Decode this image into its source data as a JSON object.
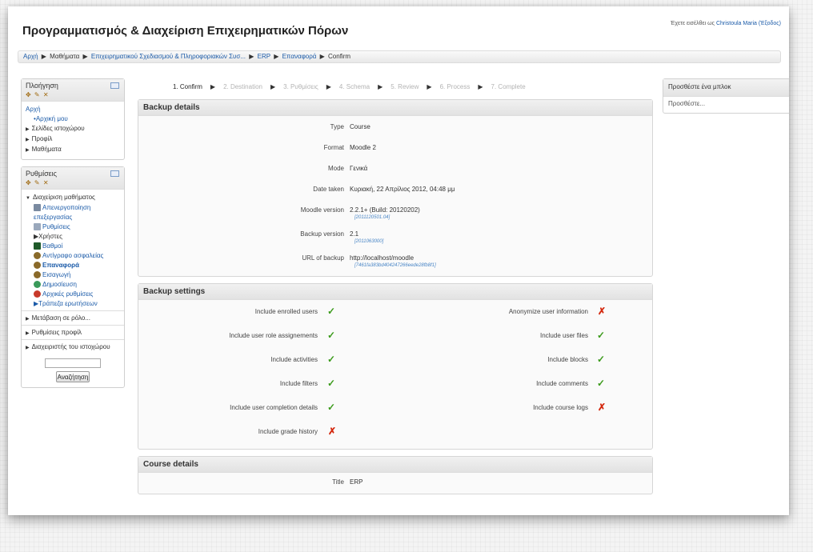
{
  "header": {
    "site_title": "Προγραμματισμός & Διαχείριση Επιχειρηματικών Πόρων",
    "login_text": "Έχετε εισέλθει ως",
    "login_user": "Christoula Maria (Έξοδος)"
  },
  "breadcrumb": {
    "items": [
      "Αρχή",
      "Μαθήματα",
      "Επιχειρηματικού Σχεδιασμού & Πληροφοριακών Συσ...",
      "ERP",
      "Επαναφορά"
    ],
    "current": "Confirm"
  },
  "navigation_block": {
    "title": "Πλοήγηση",
    "home": "Αρχή",
    "items": [
      "Αρχική μου",
      "Σελίδες ιστοχώρου",
      "Προφίλ",
      "Μαθήματα"
    ]
  },
  "settings_block": {
    "title": "Ρυθμίσεις",
    "section": "Διαχείριση μαθήματος",
    "items": [
      "Απενεργοποίηση επεξεργασίας",
      "Ρυθμίσεις",
      "Χρήστες",
      "Βαθμοί",
      "Αντίγραφο ασφαλείας",
      "Επαναφορά",
      "Εισαγωγή",
      "Δημοσίευση",
      "Αρχικές ρυθμίσεις",
      "Τράπεζα ερωτήσεων"
    ],
    "more": [
      "Μετάβαση σε ρόλο...",
      "Ρυθμίσεις προφίλ",
      "Διαχειριστής του ιστοχώρου"
    ],
    "search_button": "Αναζήτηση"
  },
  "stages": [
    "1. Confirm",
    "2. Destination",
    "3. Ρυθμίσεις",
    "4. Schema",
    "5. Review",
    "6. Process",
    "7. Complete"
  ],
  "backup_details": {
    "title": "Backup details",
    "rows": [
      {
        "label": "Type",
        "value": "Course",
        "sub": ""
      },
      {
        "label": "Format",
        "value": "Moodle 2",
        "sub": ""
      },
      {
        "label": "Mode",
        "value": "Γενικά",
        "sub": ""
      },
      {
        "label": "Date taken",
        "value": "Κυριακή, 22 Απρίλιος 2012, 04:48 μμ",
        "sub": ""
      },
      {
        "label": "Moodle version",
        "value": "2.2.1+ (Build: 20120202)",
        "sub": "[2011120501.04]"
      },
      {
        "label": "Backup version",
        "value": "2.1",
        "sub": "[2011063000]"
      },
      {
        "label": "URL of backup",
        "value": "http://localhost/moodle",
        "sub": "[7461fa383bd404247266eede28fb8f1]"
      }
    ]
  },
  "backup_settings": {
    "title": "Backup settings",
    "left": [
      {
        "label": "Include enrolled users",
        "on": true
      },
      {
        "label": "Include user role assignements",
        "on": true
      },
      {
        "label": "Include activities",
        "on": true
      },
      {
        "label": "Include filters",
        "on": true
      },
      {
        "label": "Include user completion details",
        "on": true
      },
      {
        "label": "Include grade history",
        "on": false
      }
    ],
    "right": [
      {
        "label": "Anonymize user information",
        "on": false
      },
      {
        "label": "Include user files",
        "on": true
      },
      {
        "label": "Include blocks",
        "on": true
      },
      {
        "label": "Include comments",
        "on": true
      },
      {
        "label": "Include course logs",
        "on": false
      }
    ]
  },
  "course_details": {
    "title": "Course details",
    "rows": [
      {
        "label": "Title",
        "value": "ERP"
      }
    ]
  },
  "add_block": {
    "title": "Προσθέστε ένα μπλοκ",
    "select_value": "Προσθέστε..."
  },
  "icons": {
    "check": "✓",
    "cross": "✗"
  },
  "colors": {
    "link": "#1a5aa8",
    "check": "#3a9a1a",
    "cross": "#d42a10"
  }
}
